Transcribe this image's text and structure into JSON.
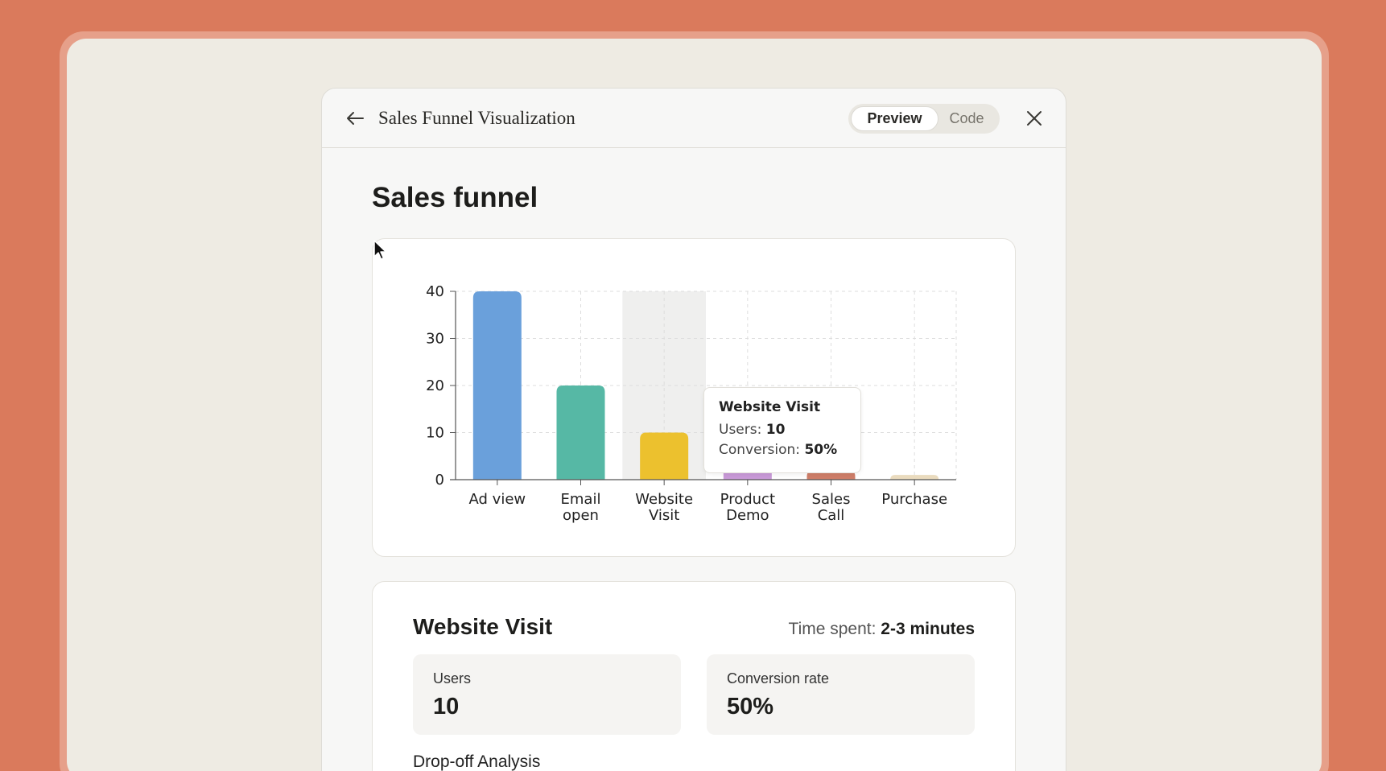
{
  "window": {
    "title": "Sales Funnel Visualization",
    "toggle": {
      "preview": "Preview",
      "code": "Code"
    }
  },
  "page": {
    "heading": "Sales funnel"
  },
  "chart_data": {
    "type": "bar",
    "categories": [
      "Ad view",
      "Email open",
      "Website Visit",
      "Product Demo",
      "Sales Call",
      "Purchase"
    ],
    "category_lines": [
      [
        "Ad view"
      ],
      [
        "Email",
        "open"
      ],
      [
        "Website",
        "Visit"
      ],
      [
        "Product",
        "Demo"
      ],
      [
        "Sales",
        "Call"
      ],
      [
        "Purchase"
      ]
    ],
    "values": [
      40,
      20,
      10,
      5,
      2,
      1
    ],
    "colors": [
      "#6aa0db",
      "#56b8a5",
      "#ecc12e",
      "#c99ad8",
      "#cf7e69",
      "#eadbbe"
    ],
    "ylim": [
      0,
      40
    ],
    "yticks": [
      0,
      10,
      20,
      30,
      40
    ],
    "grid": true,
    "highlighted_index": 2,
    "highlight_color": "#efefee"
  },
  "tooltip": {
    "title": "Website Visit",
    "users_label": "Users: ",
    "users_value": "10",
    "conversion_label": "Conversion: ",
    "conversion_value": "50%"
  },
  "detail": {
    "title": "Website Visit",
    "time_label": "Time spent: ",
    "time_value": "2-3 minutes",
    "users_label": "Users",
    "users_value": "10",
    "conversion_label": "Conversion rate",
    "conversion_value": "50%",
    "dropoff_label": "Drop-off Analysis"
  }
}
